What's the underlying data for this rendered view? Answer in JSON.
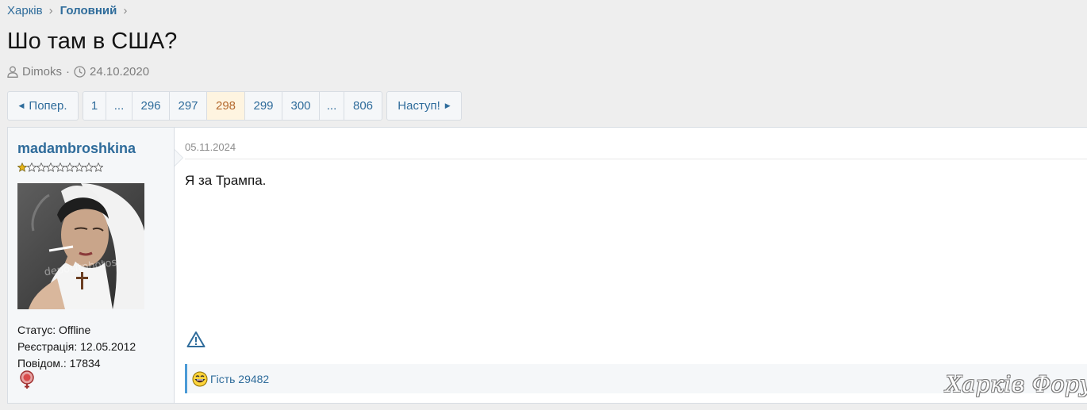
{
  "breadcrumb": [
    {
      "label": "Харків"
    },
    {
      "label": "Головний"
    }
  ],
  "thread": {
    "title": "Шо там в США?",
    "author": "Dimoks",
    "separator": "·",
    "date": "24.10.2020"
  },
  "pagination": {
    "prev_label": "Попер.",
    "next_label": "Наступ!",
    "pages": [
      "1",
      "...",
      "296",
      "297",
      "298",
      "299",
      "300",
      "...",
      "806"
    ],
    "current": "298"
  },
  "post": {
    "username": "madambroshkina",
    "rank_stars_filled": 1,
    "rank_stars_total": 9,
    "status": "Статус: Offline",
    "registration": "Реєстрація: 12.05.2012",
    "posts": "Повідом.: 17834",
    "date": "05.11.2024",
    "body": "Я за Трампа.",
    "reaction_user": "Гість 29482",
    "avatar_watermark": "depositphotos"
  },
  "watermark": "Харків Форум",
  "colors": {
    "link": "#2f6c9b",
    "current_page_bg": "#fef4e0",
    "current_page_text": "#b4692e",
    "reaction_border": "#4b9ad6"
  },
  "icons": {
    "author": "user-icon",
    "date": "clock-icon",
    "report": "warning-icon",
    "gender": "female-icon",
    "reaction": "laugh-emoji-icon"
  }
}
